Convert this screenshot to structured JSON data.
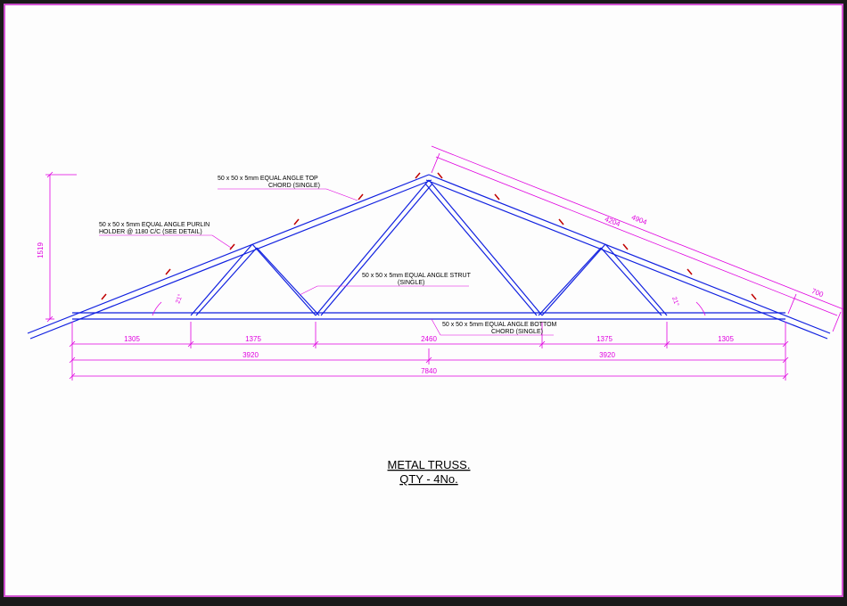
{
  "title_line1": "METAL TRUSS.",
  "title_line2": "QTY - 4No.",
  "labels": {
    "top_chord": "50 x 50 x 5mm EQUAL ANGLE TOP CHORD (SINGLE)",
    "purlin_holder": "50 x 50 x 5mm EQUAL ANGLE PURLIN HOLDER @ 1180 C/C (SEE DETAIL)",
    "strut": "50 x 50 x 5mm EQUAL ANGLE STRUT (SINGLE)",
    "bottom_chord": "50 x 50 x 5mm EQUAL ANGLE BOTTOM CHORD (SINGLE)"
  },
  "dimensions": {
    "height": "1519",
    "span_total": "7840",
    "span_half_left": "3920",
    "span_half_right": "3920",
    "seg1": "1305",
    "seg2": "1375",
    "seg3": "2460",
    "seg4": "1375",
    "seg5": "1305",
    "overhang": "700",
    "top_chord_full": "4904",
    "top_chord_inner": "4204",
    "angle": "21°"
  }
}
